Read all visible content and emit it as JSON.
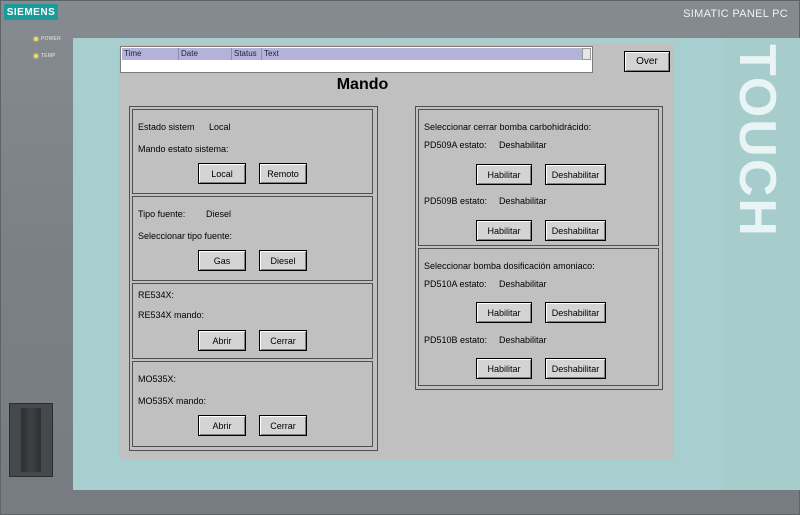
{
  "device": {
    "brand": "SIEMENS",
    "model": "SIMATIC PANEL PC",
    "led_power": "POWER",
    "led_temp": "TEMP",
    "side_label": "TOUCH"
  },
  "alarm_view": {
    "columns": [
      "Time",
      "Date",
      "Status",
      "Text"
    ]
  },
  "over_button": "Over",
  "title": "Mando",
  "left_panels": {
    "sistema": {
      "status_label": "Estado sistem",
      "status_value": "Local",
      "mando_label": "Mando estato sistema:",
      "btn_local": "Local",
      "btn_remoto": "Remoto"
    },
    "fuente": {
      "status_label": "Tipo fuente:",
      "status_value": "Diesel",
      "select_label": "Seleccionar tipo fuente:",
      "btn_gas": "Gas",
      "btn_diesel": "Diesel"
    },
    "re534x": {
      "label": "RE534X:",
      "mando_label": "RE534X mando:",
      "btn_abrir": "Abrir",
      "btn_cerrar": "Cerrar"
    },
    "mo535x": {
      "label": "MO535X:",
      "mando_label": "MO535X mando:",
      "btn_abrir": "Abrir",
      "btn_cerrar": "Cerrar"
    }
  },
  "right_panels": {
    "carbo": {
      "header": "Seleccionar cerrar bomba carbohidrácido:",
      "pd509a_label": "PD509A estato:",
      "pd509a_value": "Deshabilitar",
      "pd509b_label": "PD509B estato:",
      "pd509b_value": "Deshabilitar",
      "btn_habilitar": "Habilitar",
      "btn_deshabilitar": "Deshabilitar"
    },
    "amoniaco": {
      "header": "Seleccionar bomba dosificación amoniaco:",
      "pd510a_label": "PD510A estato:",
      "pd510a_value": "Deshabilitar",
      "pd510b_label": "PD510B estato:",
      "pd510b_value": "Deshabilitar",
      "btn_habilitar": "Habilitar",
      "btn_deshabilitar": "Deshabilitar"
    }
  },
  "colors": {
    "brand_teal": "#1d9a9a",
    "screen_frame": "#a7cfcf",
    "hmi_background": "#c0c0c0",
    "alarm_header": "#b3b3d9"
  }
}
